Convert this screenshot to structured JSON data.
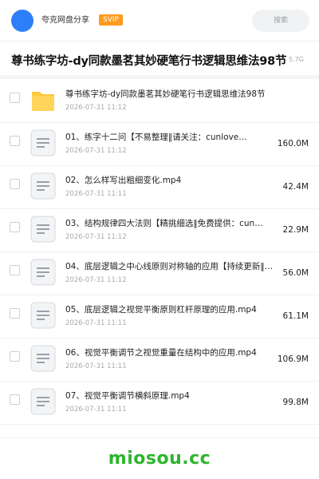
{
  "header": {
    "brand": "夸克网盘分享",
    "badge": "SVIP",
    "search_label": "搜索"
  },
  "share": {
    "title": "尊书练字坊-dy同款墨茗其妙硬笔行书逻辑思维法98节",
    "total_size": "5.7G"
  },
  "files": [
    {
      "type": "folder",
      "name": "尊书练字坊-dy同款墨茗其妙硬笔行书逻辑思维法98节",
      "date": "2026-07-31 11:12",
      "size": ""
    },
    {
      "type": "file",
      "name": "01、练字十二问【不易整理‖请关注：cunlove…",
      "date": "2026-07-31 11:12",
      "size": "160.0M"
    },
    {
      "type": "file",
      "name": "02、怎么样写出粗细变化.mp4",
      "date": "2026-07-31 11:11",
      "size": "42.4M"
    },
    {
      "type": "file",
      "name": "03、结构规律四大法则【精挑细选‖免费提供：cun…",
      "date": "2026-07-31 11:12",
      "size": "22.9M"
    },
    {
      "type": "file",
      "name": "04、底层逻辑之中心线原则对称轴的应用【持续更新‖…",
      "date": "2026-07-31 11:12",
      "size": "56.0M"
    },
    {
      "type": "file",
      "name": "05、底层逻辑之视觉平衡原则杠杆原理的应用.mp4",
      "date": "2026-07-31 11:11",
      "size": "61.1M"
    },
    {
      "type": "file",
      "name": "06、视觉平衡调节之视觉重量在结构中的应用.mp4",
      "date": "2026-07-31 11:11",
      "size": "106.9M"
    },
    {
      "type": "file",
      "name": "07、视觉平衡调节横斜原理.mp4",
      "date": "2026-07-31 11:11",
      "size": "99.8M"
    }
  ],
  "watermark": "miosou.cc",
  "colors": {
    "accent": "#2d7ff9",
    "svip": "#ff9a1f",
    "folder": "#ffc93c",
    "watermark": "#2eb52e"
  }
}
